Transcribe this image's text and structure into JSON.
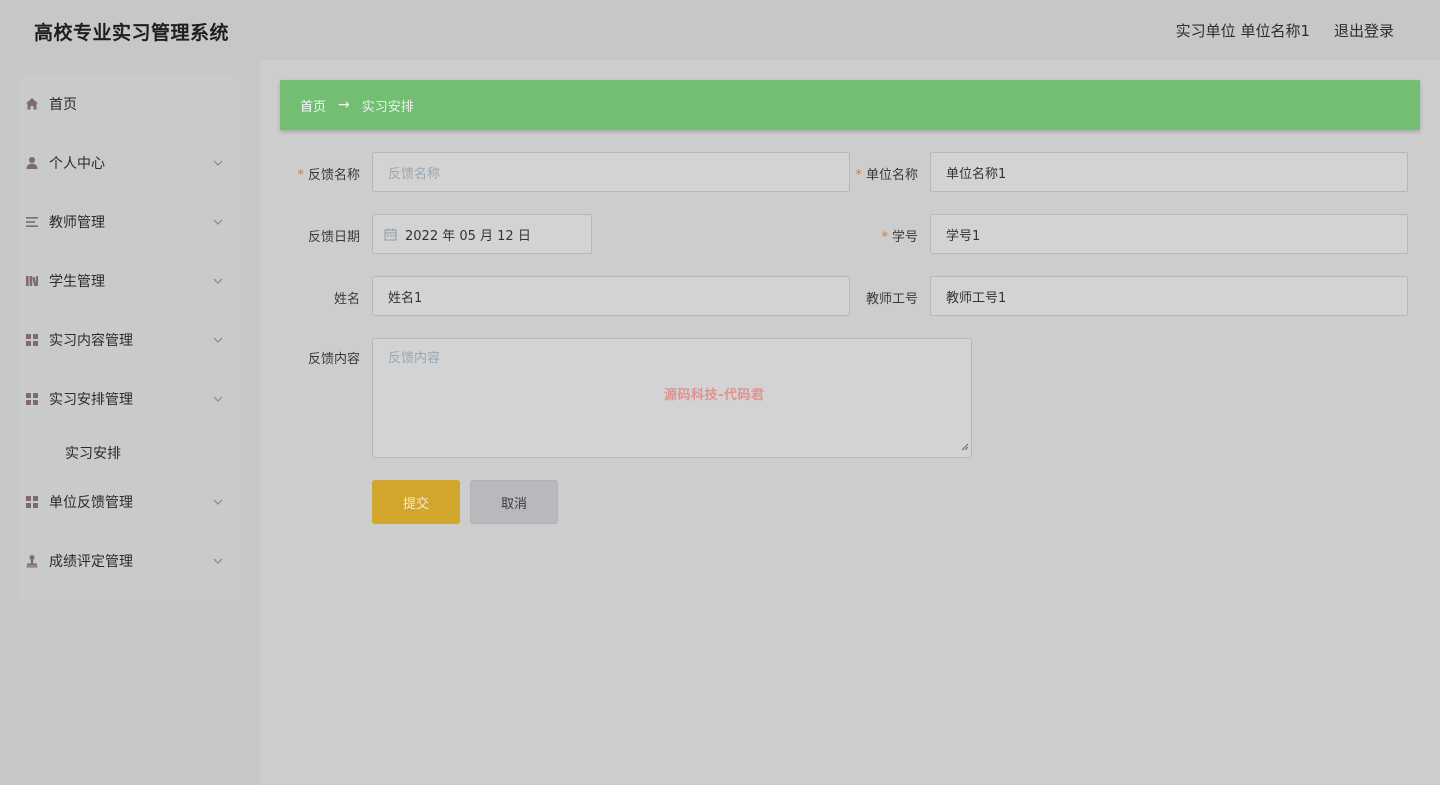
{
  "header": {
    "app_title": "高校专业实习管理系统",
    "user_label": "实习单位 单位名称1",
    "logout_label": "退出登录"
  },
  "sidebar": {
    "items": [
      {
        "label": "首页",
        "icon": "home-icon"
      },
      {
        "label": "个人中心",
        "icon": "user-icon"
      },
      {
        "label": "教师管理",
        "icon": "list-icon"
      },
      {
        "label": "学生管理",
        "icon": "books-icon"
      },
      {
        "label": "实习内容管理",
        "icon": "grid-icon"
      },
      {
        "label": "实习安排管理",
        "icon": "grid-icon"
      },
      {
        "label": "单位反馈管理",
        "icon": "grid-icon"
      },
      {
        "label": "成绩评定管理",
        "icon": "stamp-icon"
      }
    ],
    "sub_item": "实习安排"
  },
  "breadcrumb": {
    "home": "首页",
    "arrow": "→",
    "current": "实习安排"
  },
  "form": {
    "feedback_name": {
      "label": "反馈名称",
      "placeholder": "反馈名称",
      "required": true
    },
    "unit_name": {
      "label": "单位名称",
      "value": "单位名称1",
      "required": true
    },
    "feedback_date": {
      "label": "反馈日期",
      "value": "2022 年 05 月 12 日"
    },
    "student_no": {
      "label": "学号",
      "value": "学号1",
      "required": true
    },
    "name": {
      "label": "姓名",
      "value": "姓名1"
    },
    "teacher_no": {
      "label": "教师工号",
      "value": "教师工号1"
    },
    "feedback_content": {
      "label": "反馈内容",
      "placeholder": "反馈内容"
    },
    "required_mark": "*",
    "submit_label": "提交",
    "cancel_label": "取消"
  },
  "watermark": "源码科技-代码君",
  "colors": {
    "breadcrumb_bg": "#74be74",
    "submit_bg": "#d2a52c",
    "cancel_bg": "#b8b9bc",
    "required": "#c9853c",
    "watermark": "#e39090"
  }
}
